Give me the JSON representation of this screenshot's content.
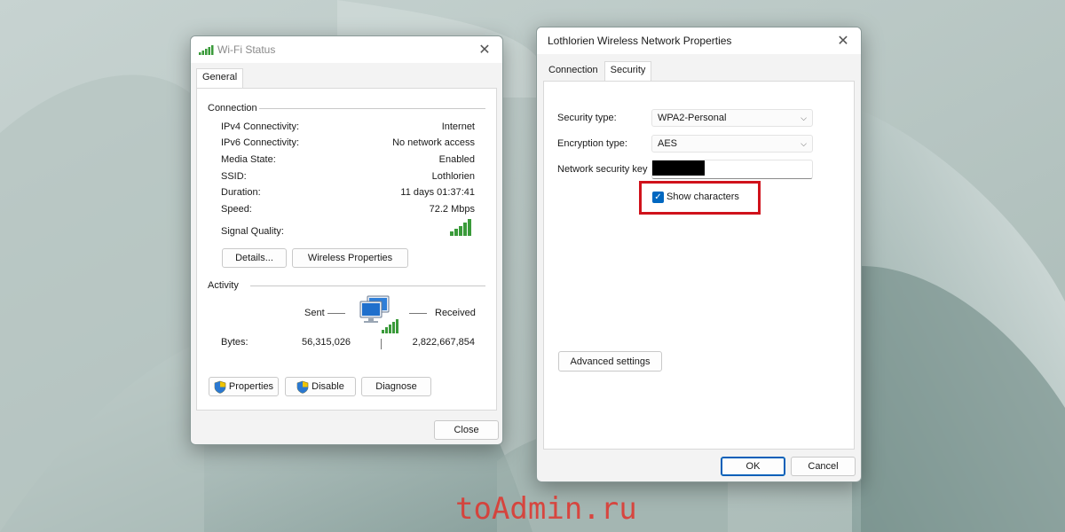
{
  "wifi_status": {
    "title": "Wi-Fi Status",
    "tab": "General",
    "connection": {
      "heading": "Connection",
      "rows": [
        {
          "label": "IPv4 Connectivity:",
          "value": "Internet"
        },
        {
          "label": "IPv6 Connectivity:",
          "value": "No network access"
        },
        {
          "label": "Media State:",
          "value": "Enabled"
        },
        {
          "label": "SSID:",
          "value": "Lothlorien"
        },
        {
          "label": "Duration:",
          "value": "11 days 01:37:41"
        },
        {
          "label": "Speed:",
          "value": "72.2 Mbps"
        }
      ],
      "signal_label": "Signal Quality:",
      "details_button": "Details...",
      "wireless_properties_button": "Wireless Properties"
    },
    "activity": {
      "heading": "Activity",
      "sent_label": "Sent",
      "received_label": "Received",
      "bytes_label": "Bytes:",
      "bytes_sent": "56,315,026",
      "bytes_received": "2,822,667,854"
    },
    "buttons": {
      "properties": "Properties",
      "disable": "Disable",
      "diagnose": "Diagnose",
      "close": "Close"
    }
  },
  "network_properties": {
    "title": "Lothlorien Wireless Network Properties",
    "tabs": [
      "Connection",
      "Security"
    ],
    "active_tab": "Security",
    "security_type_label": "Security type:",
    "security_type_value": "WPA2-Personal",
    "encryption_type_label": "Encryption type:",
    "encryption_type_value": "AES",
    "network_key_label": "Network security key",
    "show_characters_label": "Show characters",
    "show_characters_checked": true,
    "advanced_button": "Advanced settings",
    "ok_button": "OK",
    "cancel_button": "Cancel"
  },
  "watermark": "toAdmin.ru",
  "colors": {
    "accent": "#0067c0",
    "highlight": "#d0121b",
    "watermark": "#e0332c",
    "signal": "#3a9a3a"
  }
}
